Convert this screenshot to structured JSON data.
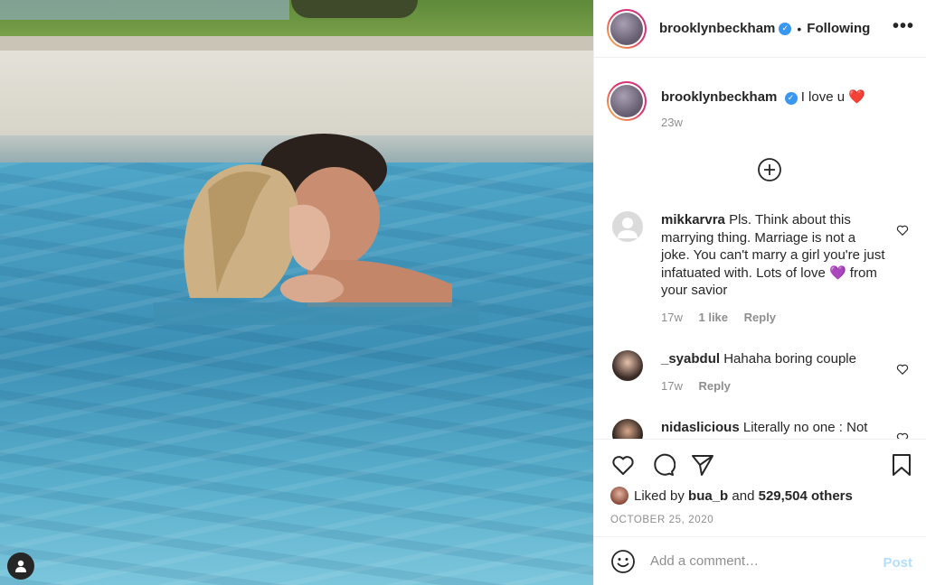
{
  "post": {
    "author": "brooklynbeckham",
    "follow_status": "Following",
    "more_glyph": "•••",
    "dot": "•",
    "verified_glyph": "✓"
  },
  "caption": {
    "author": "brooklynbeckham",
    "text": "I love u",
    "emoji": "❤️",
    "time": "23w"
  },
  "comments": [
    {
      "user": "mikkarvra",
      "text": "Pls. Think about this marrying thing. Marriage is not a joke. You can't marry a girl you're just infatuated with. Lots of love",
      "emoji": "💜",
      "text_after": " from your savior",
      "time": "17w",
      "likes": "1 like",
      "reply": "Reply"
    },
    {
      "user": "_syabdul",
      "text": "Hahaha boring couple",
      "time": "17w",
      "reply": "Reply"
    },
    {
      "user": "nidaslicious",
      "text": "Literally no one : Not"
    }
  ],
  "likes": {
    "prefix": "Liked by",
    "user": "bua_b",
    "middle": "and",
    "others": "529,504 others"
  },
  "date": "OCTOBER 25, 2020",
  "add_comment": {
    "placeholder": "Add a comment…",
    "post_label": "Post"
  },
  "icons": [
    "heart-icon",
    "comment-icon",
    "share-icon",
    "bookmark-icon",
    "emoji-icon",
    "add-circle-icon",
    "more-icon",
    "verified-icon",
    "user-icon"
  ]
}
